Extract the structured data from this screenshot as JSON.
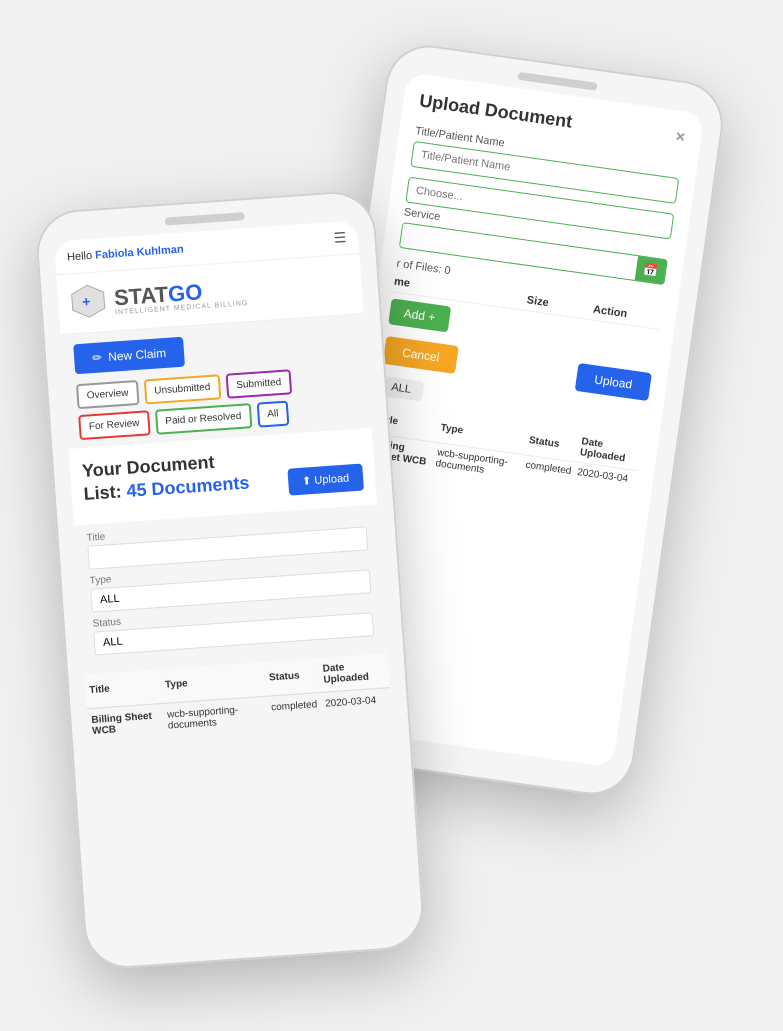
{
  "scene": {
    "background": "#f0f0f0"
  },
  "back_phone": {
    "upload_title": "Upload Document",
    "close_icon": "×",
    "title_label": "Title/Patient Name",
    "title_placeholder": "Title/Patient Name",
    "choose_placeholder": "Choose...",
    "service_label": "Service",
    "file_count_label": "r of Files: 0",
    "table_col_name": "me",
    "table_col_size": "Size",
    "table_col_action": "Action",
    "add_btn_label": "Add +",
    "cancel_btn_label": "Cancel",
    "upload_btn_label": "Upload",
    "filter_all": "ALL",
    "doc_table_cols": {
      "title": "Title",
      "type": "Type",
      "status": "Status",
      "date": "Date Uploaded"
    },
    "doc_rows": [
      {
        "title": "Billing Sheet WCB",
        "type": "wcb-supporting-documents",
        "status": "completed",
        "date": "2020-03-04"
      }
    ]
  },
  "front_phone": {
    "hello_prefix": "Hello",
    "hello_name": "Fabiola Kuhlman",
    "logo_stat": "STAT",
    "logo_go": "GO",
    "logo_sub": "INTELLIGENT MEDICAL BILLING",
    "new_claim_label": "New Claim",
    "pencil_icon": "✏",
    "upload_icon": "⬆",
    "tabs": [
      {
        "label": "Overview",
        "color": "overview"
      },
      {
        "label": "Unsubmitted",
        "color": "unsubmitted"
      },
      {
        "label": "Submitted",
        "color": "submitted"
      },
      {
        "label": "For Review",
        "color": "review"
      },
      {
        "label": "Paid or Resolved",
        "color": "paid"
      },
      {
        "label": "All",
        "color": "all"
      }
    ],
    "doc_heading_line1": "Your Document",
    "doc_heading_line2": "List:",
    "doc_count": "45 Documents",
    "upload_btn_label": "Upload",
    "title_label": "Title",
    "type_label": "Type",
    "type_value": "ALL",
    "status_label": "Status",
    "status_value": "ALL",
    "table_cols": {
      "title": "Title",
      "type": "Type",
      "status": "Status",
      "date": "Date Uploaded"
    },
    "doc_rows": [
      {
        "title": "Billing Sheet WCB",
        "type": "wcb-supporting-documents",
        "status": "completed",
        "date": "2020-03-04"
      }
    ]
  }
}
